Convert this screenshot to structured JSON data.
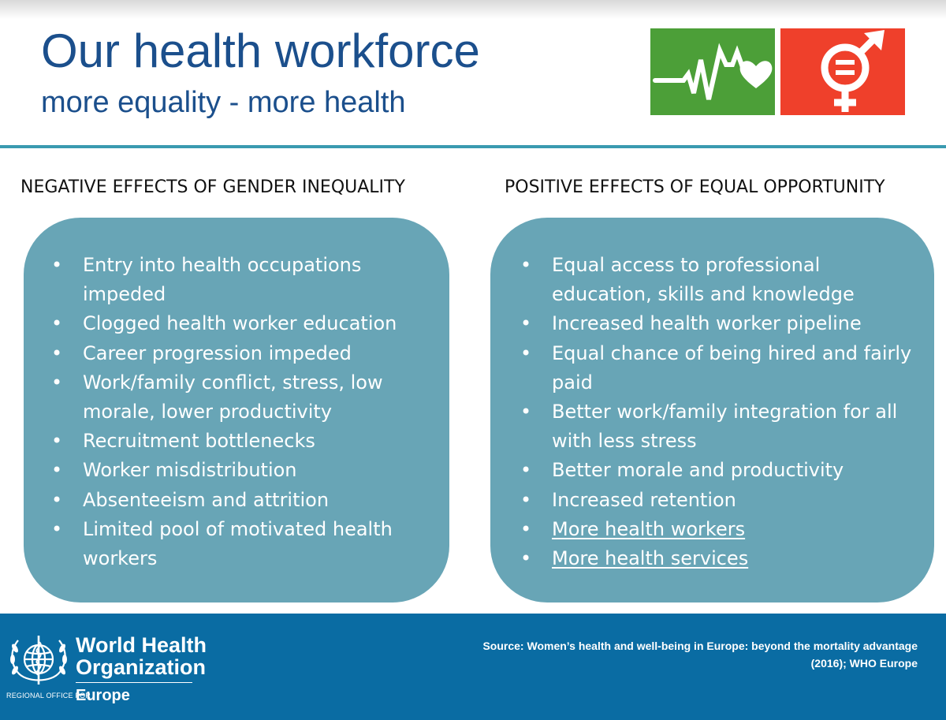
{
  "header": {
    "title": "Our health workforce",
    "subtitle": "more equality - more health",
    "icons": [
      "sdg3-good-health-icon",
      "sdg5-gender-equality-icon"
    ],
    "colors": {
      "title": "#1b4f8c",
      "sdg3": "#4c9f38",
      "sdg5": "#ef402b",
      "divider": "#3a9ab0"
    }
  },
  "negative": {
    "heading": "NEGATIVE EFFECTS OF GENDER INEQUALITY",
    "items": [
      "Entry into health occupations impeded",
      "Clogged health worker education",
      "Career progression impeded",
      "Work/family conflict, stress, low morale, lower productivity",
      "Recruitment bottlenecks",
      "Worker misdistribution",
      "Absenteeism and attrition",
      "Limited pool of motivated health workers"
    ]
  },
  "positive": {
    "heading": "POSITIVE EFFECTS OF EQUAL OPPORTUNITY",
    "items": [
      "Equal access to professional education, skills and knowledge",
      "Increased health worker pipeline",
      "Equal chance of being hired and fairly paid",
      "Better work/family integration for all with less stress",
      "Better morale and productivity",
      "Increased retention",
      "More health workers",
      "More health services"
    ]
  },
  "panel_color": "#68a5b6",
  "footer": {
    "org_line1": "World Health",
    "org_line2": "Organization",
    "regional": "REGIONAL OFFICE FOR",
    "region": "Europe",
    "source": "Source: Women’s health and well-being in Europe: beyond the  mortality advantage (2016); WHO Europe",
    "color": "#0a6ca3"
  }
}
